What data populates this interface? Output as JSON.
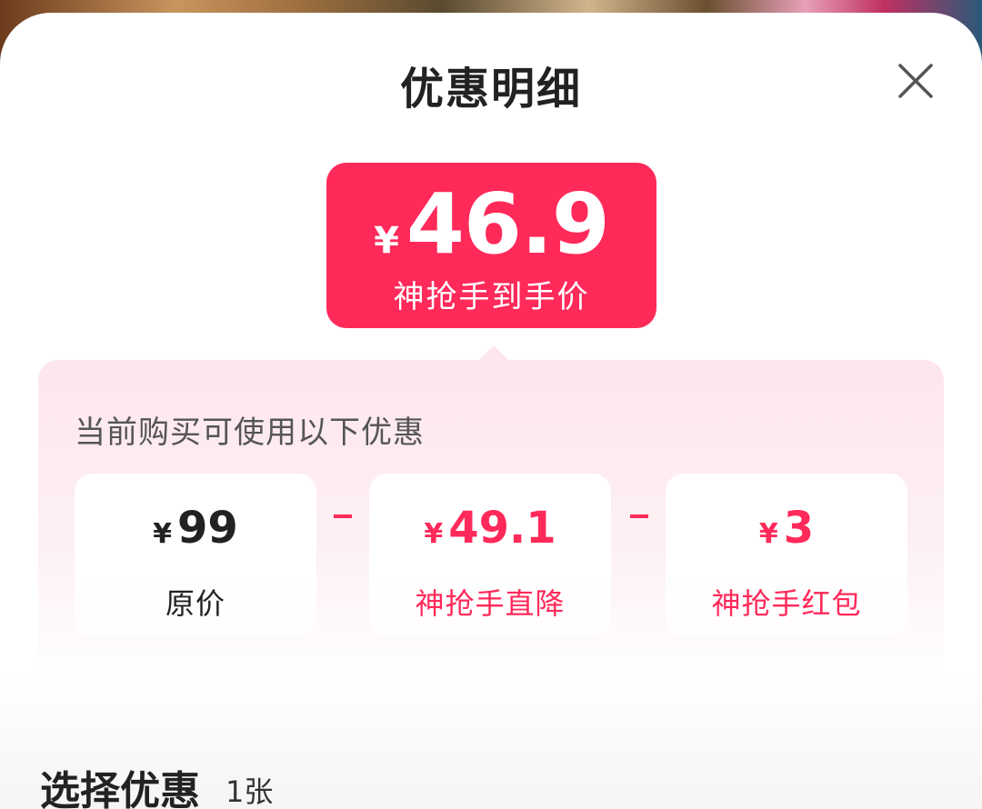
{
  "header": {
    "title": "优惠明细",
    "close_icon": "close-icon"
  },
  "final_price": {
    "currency": "¥",
    "value": "46.9",
    "label": "神抢手到手价"
  },
  "discount_panel": {
    "title": "当前购买可使用以下优惠",
    "items": [
      {
        "currency": "¥",
        "value": "99",
        "label": "原价"
      },
      {
        "currency": "¥",
        "value": "49.1",
        "label": "神抢手直降"
      },
      {
        "currency": "¥",
        "value": "3",
        "label": "神抢手红包"
      }
    ],
    "operator": "-"
  },
  "select_section": {
    "title": "选择优惠",
    "count": "1张"
  },
  "colors": {
    "accent": "#ff2a5a",
    "panel_bg": "#fde6ec",
    "text_dark": "#222222"
  }
}
